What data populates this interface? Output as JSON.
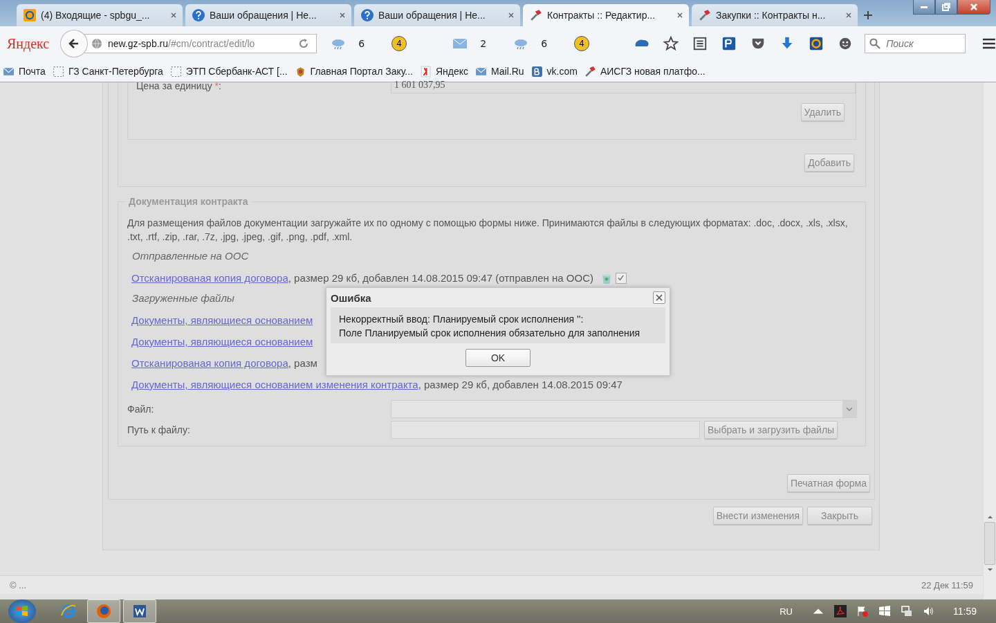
{
  "browser": {
    "tabs": [
      {
        "title": "(4) Входящие - spbgu_...",
        "kind": "mail",
        "selected": false
      },
      {
        "title": "Ваши обращения | Не...",
        "kind": "help",
        "selected": false
      },
      {
        "title": "Ваши обращения | Не...",
        "kind": "help",
        "selected": false
      },
      {
        "title": "Контракты :: Редактир...",
        "kind": "tools",
        "selected": true
      },
      {
        "title": "Закупки :: Контракты н...",
        "kind": "tools",
        "selected": false
      }
    ],
    "logo": "Яндекс",
    "url_host": "new.gz-spb.ru",
    "url_path": "/#cm/contract/edit/lo",
    "widgets": [
      {
        "kind": "weather",
        "text": "6"
      },
      {
        "kind": "badge",
        "text": "4"
      },
      {
        "kind": "mail",
        "text": "2"
      },
      {
        "kind": "weather",
        "text": "6"
      },
      {
        "kind": "badge",
        "text": "4"
      }
    ],
    "search_placeholder": "Поиск",
    "bookmarks": [
      {
        "title": "Почта",
        "kind": "mail"
      },
      {
        "title": "ГЗ Санкт-Петербурга",
        "kind": "blank"
      },
      {
        "title": "ЭТП Сбербанк-АСТ [...",
        "kind": "blank"
      },
      {
        "title": "Главная Портал Заку...",
        "kind": "emblem"
      },
      {
        "title": "Яндекс",
        "kind": "yandex"
      },
      {
        "title": "Mail.Ru",
        "kind": "mail"
      },
      {
        "title": "vk.com",
        "kind": "vk"
      },
      {
        "title": "АИСГЗ новая платфо...",
        "kind": "tools"
      }
    ]
  },
  "page": {
    "price_label": "Цена за единицу",
    "required_mark": "*",
    "price_label_end": ":",
    "price_value": "1 601 037,95",
    "delete_button": "Удалить",
    "add_button": "Добавить",
    "docs": {
      "legend": "Документация контракта",
      "intro": "Для размещения файлов документации загружайте их по одному с помощью формы ниже. Принимаются файлы в следующих форматах: .doc, .docx, .xls, .xlsx, .txt, .rtf, .zip, .rar, .7z, .jpg, .jpeg, .gif, .png, .pdf, .xml.",
      "sent_heading": "Отправленные на ООС",
      "sent_files": [
        {
          "link": "Отсканированая копия договора",
          "details": ", размер 29 кб, добавлен 14.08.2015 09:47 (отправлен на ООС)",
          "checked": true
        }
      ],
      "uploaded_heading": "Загруженные файлы",
      "uploaded_files": [
        {
          "link": "Документы, являющиеся основанием"
        },
        {
          "link": "Документы, являющиеся основанием"
        },
        {
          "link": "Отсканированая копия договора",
          "details": ", разм"
        },
        {
          "link": "Документы, являющиеся основанием изменения контракта",
          "details": ", размер 29 кб, добавлен 14.08.2015 09:47"
        }
      ],
      "file_label": "Файл:",
      "path_label": "Путь к файлу:",
      "upload_button": "Выбрать и загрузить файлы"
    },
    "print_button": "Печатная форма",
    "save_button": "Внести изменения",
    "close_button": "Закрыть",
    "copyright": "© ...",
    "timestamp": "22 Дек 11:59"
  },
  "dialog": {
    "title": "Ошибка",
    "lines": [
      "Некорректный ввод: Планируемый срок исполнения '':",
      "Поле Планируемый срок исполнения обязательно для заполнения"
    ],
    "ok_button": "OK"
  },
  "taskbar": {
    "apps": [
      {
        "kind": "ie",
        "selected": false
      },
      {
        "kind": "firefox",
        "selected": true
      },
      {
        "kind": "word",
        "selected": true
      }
    ],
    "language": "RU",
    "clock": "11:59"
  }
}
